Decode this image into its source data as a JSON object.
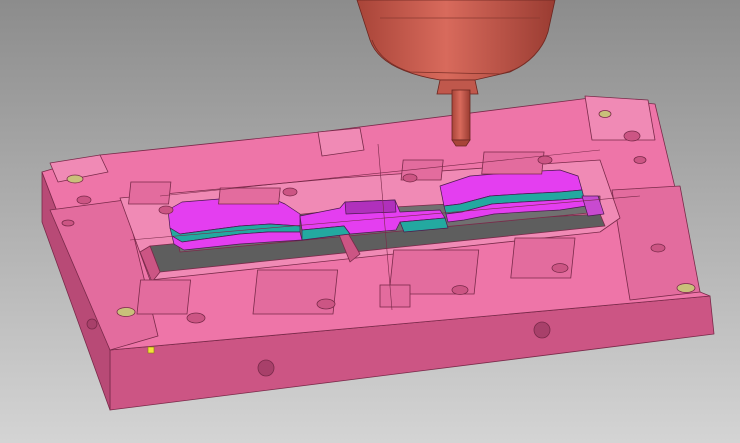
{
  "viewport": {
    "background_top": "#8c8c8c",
    "background_bottom": "#d4d4d4"
  },
  "colors": {
    "mold_top": "#ee75a8",
    "mold_front": "#cc5584",
    "mold_side": "#b84a76",
    "mold_edge": "#7a2a4a",
    "cavity_floor": "#5e5e5e",
    "part_magenta": "#e43ef0",
    "part_teal": "#23a9a0",
    "spindle": "#c0584c",
    "indicator": "#f2e23a"
  },
  "icons": [
    "cutting-tool-spindle-icon",
    "origin-marker-icon"
  ]
}
